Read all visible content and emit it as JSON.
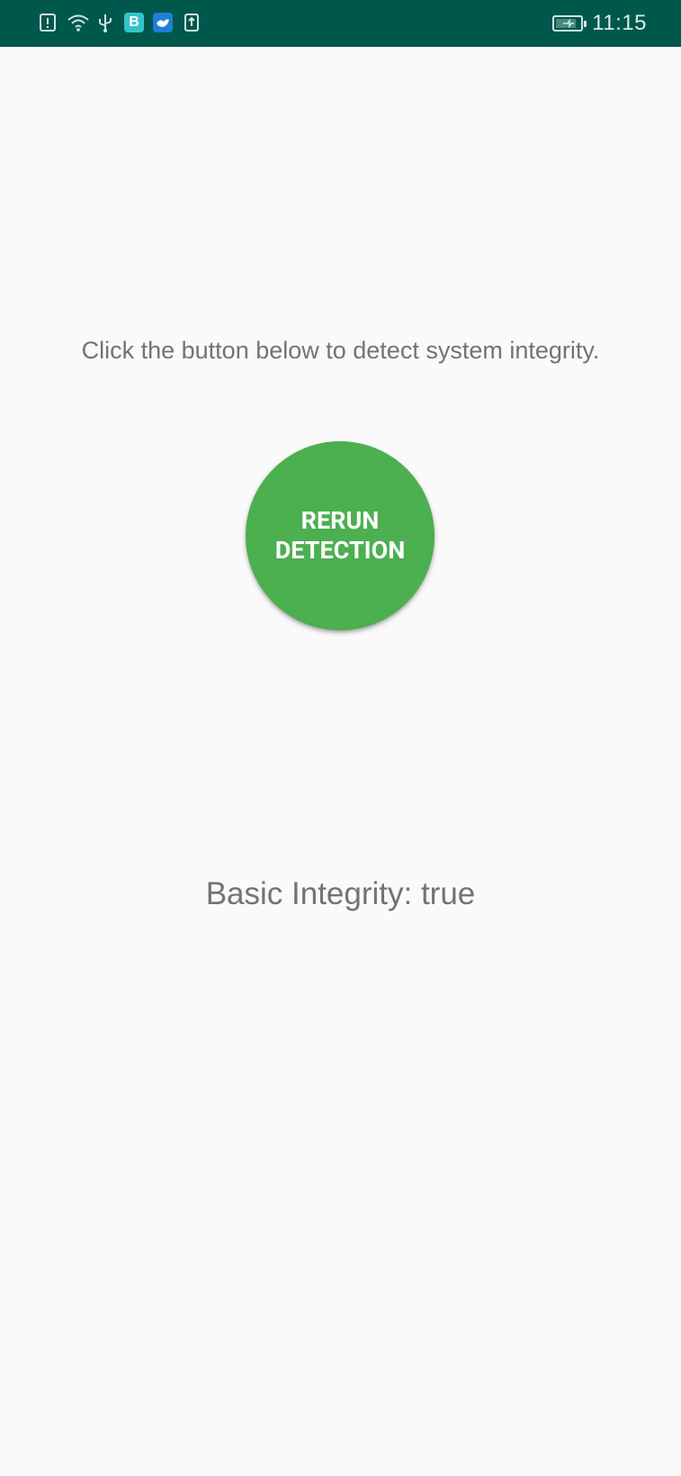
{
  "status_bar": {
    "time": "11:15",
    "background_color": "#00574b",
    "left_icons": [
      "sim-alert-icon",
      "wifi-icon",
      "usb-icon",
      "app-b-icon",
      "app-bird-icon",
      "upload-icon"
    ],
    "right_icons": [
      "battery-charging-icon"
    ],
    "app_badge_b_label": "B"
  },
  "main": {
    "instruction_text": "Click the button below to detect system integrity.",
    "button_label": "RERUN DETECTION",
    "button_color": "#4caf50",
    "result_text": "Basic Integrity: true"
  }
}
